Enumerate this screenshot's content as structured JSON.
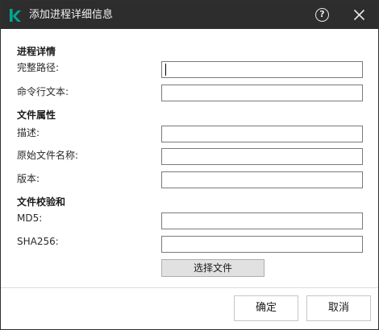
{
  "window": {
    "title": "添加进程详细信息",
    "help_symbol": "?"
  },
  "sections": {
    "process_details": "进程详情",
    "file_attributes": "文件属性",
    "file_checksum": "文件校验和"
  },
  "fields": {
    "full_path": {
      "label": "完整路径:",
      "value": ""
    },
    "command_line": {
      "label": "命令行文本:",
      "value": ""
    },
    "description": {
      "label": "描述:",
      "value": ""
    },
    "original_file_name": {
      "label": "原始文件名称:",
      "value": ""
    },
    "version": {
      "label": "版本:",
      "value": ""
    },
    "md5": {
      "label": "MD5:",
      "value": ""
    },
    "sha256": {
      "label": "SHA256:",
      "value": ""
    }
  },
  "buttons": {
    "choose_file": "选择文件",
    "ok": "确定",
    "cancel": "取消"
  },
  "icons": {
    "app": "kaspersky-logo-icon",
    "help": "help-circle-icon",
    "close": "close-icon"
  },
  "colors": {
    "titlebar": "#2d2d2d",
    "brand": "#00a88e"
  }
}
